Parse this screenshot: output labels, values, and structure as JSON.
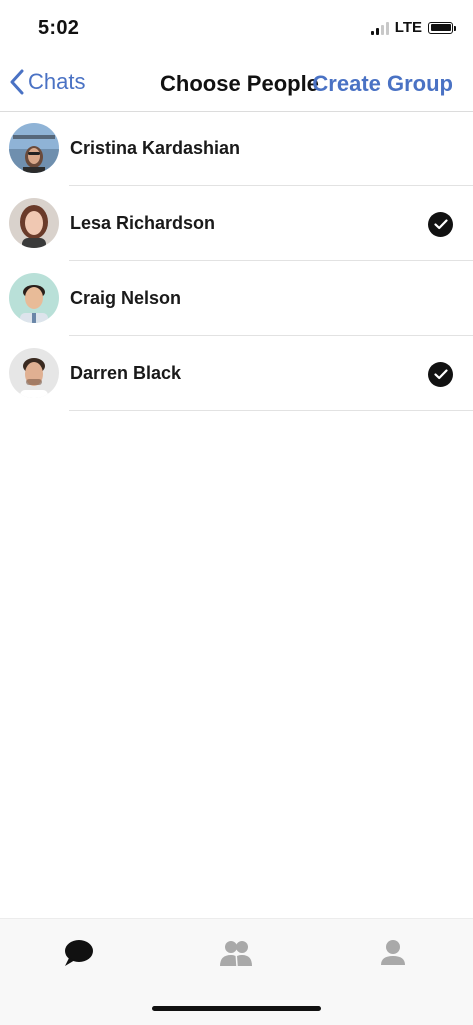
{
  "status_bar": {
    "time": "5:02",
    "network": "LTE",
    "signal_bars_active": 2,
    "signal_bars_total": 4
  },
  "nav": {
    "back_label": "Chats",
    "title": "Choose People",
    "action_label": "Create Group"
  },
  "people": [
    {
      "name": "Cristina Kardashian",
      "selected": false,
      "avatar_icon": "avatar-photo"
    },
    {
      "name": "Lesa Richardson",
      "selected": true,
      "avatar_icon": "avatar-photo"
    },
    {
      "name": "Craig Nelson",
      "selected": false,
      "avatar_icon": "avatar-photo"
    },
    {
      "name": "Darren Black",
      "selected": true,
      "avatar_icon": "avatar-photo"
    }
  ],
  "tab_bar": {
    "tabs": [
      {
        "icon": "chat-bubble-icon",
        "active": true
      },
      {
        "icon": "contacts-icon",
        "active": false
      },
      {
        "icon": "profile-icon",
        "active": false
      }
    ]
  },
  "colors": {
    "accent": "#4a72c4",
    "active_tab": "#111111",
    "inactive_tab": "#a9a9a9"
  }
}
